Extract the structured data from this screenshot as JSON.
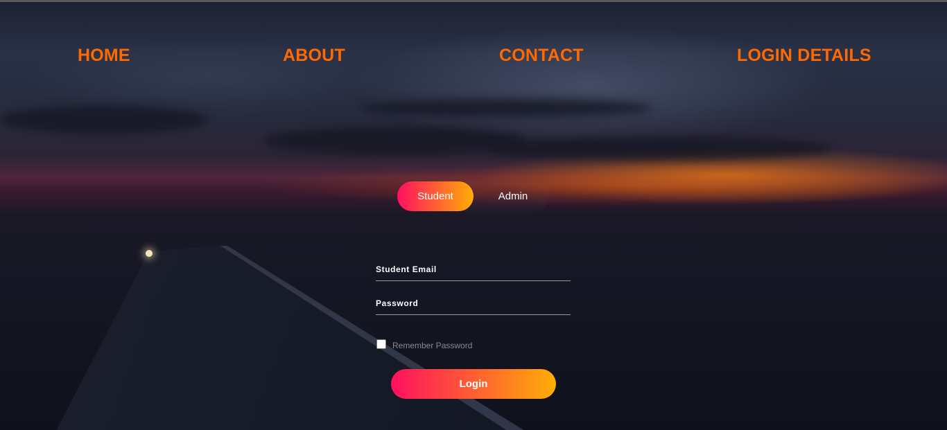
{
  "nav": {
    "items": [
      {
        "label": "HOME"
      },
      {
        "label": "ABOUT"
      },
      {
        "label": "CONTACT"
      },
      {
        "label": "LOGIN DETAILS"
      }
    ]
  },
  "login_toggle": {
    "active_label": "Student",
    "inactive_label": "Admin"
  },
  "form": {
    "email_placeholder": "Student Email",
    "password_placeholder": "Password",
    "remember_label": "Remember Password",
    "remember_checked": false,
    "submit_label": "Login"
  },
  "colors": {
    "nav_text": "#ff6a00",
    "gradient_start": "#ff105f",
    "gradient_end": "#ffad06"
  }
}
